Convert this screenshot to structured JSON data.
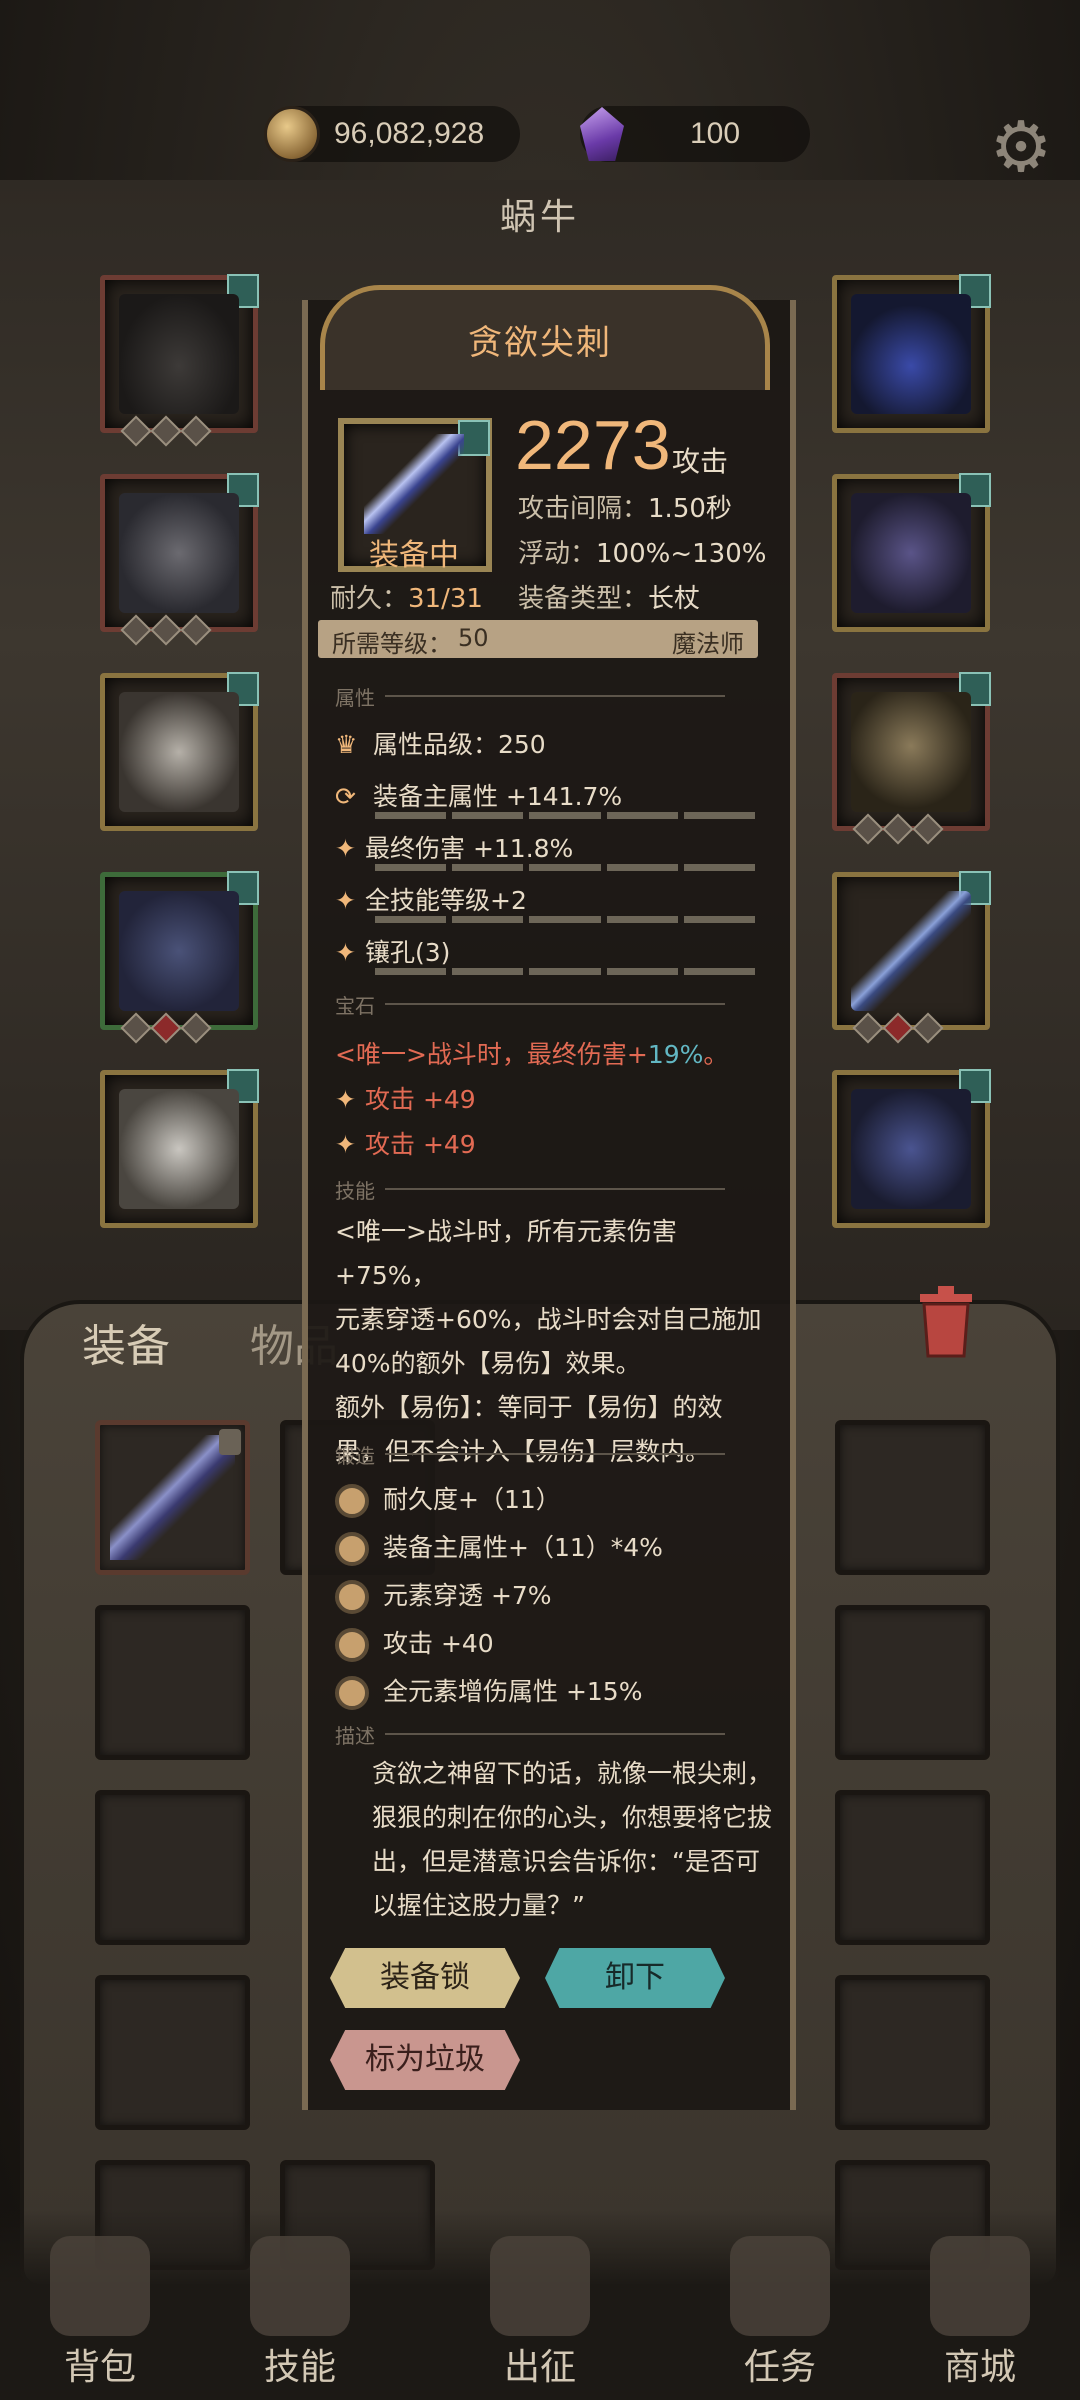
{
  "currency": {
    "gold": "96,082,928",
    "gems": "100"
  },
  "character_name": "蜗牛",
  "inventory_tabs": {
    "equip": "装备",
    "items": "物品"
  },
  "item": {
    "name": "贪欲尖刺",
    "status": "装备中",
    "attack_value": "2273",
    "attack_label": "攻击",
    "attack_interval_label": "攻击间隔：",
    "attack_interval": "1.50秒",
    "variance_label": "浮动：",
    "variance": "100%~130%",
    "durability_label": "耐久：",
    "durability": "31/31",
    "type_label": "装备类型：",
    "type": "长杖",
    "req_level_label": "所需等级：",
    "req_level": "50",
    "req_class": "魔法师"
  },
  "sections": {
    "attributes": "属性",
    "gems": "宝石",
    "skills": "技能",
    "forge": "锻造",
    "description": "描述"
  },
  "attributes": {
    "grade": "属性品级：250",
    "main": "装备主属性 +141.7%",
    "rows": [
      "最终伤害 +11.8%",
      "全技能等级+2",
      "镶孔(3)"
    ]
  },
  "gems": {
    "unique_prefix": "<唯一>战斗时，最终伤害+",
    "unique_value": "19%",
    "unique_suffix": "。",
    "rows": [
      "攻击 +49",
      "攻击 +49"
    ]
  },
  "skill_lines": [
    "<唯一>战斗时，所有元素伤害+75%，",
    "元素穿透+60%，战斗时会对自己施加",
    "40%的额外【易伤】效果。",
    "额外【易伤】：等同于【易伤】的效",
    "果，但不会计入【易伤】层数内。"
  ],
  "forge": [
    "耐久度+（11）",
    "装备主属性+（11）*4%",
    "元素穿透 +7%",
    "攻击 +40",
    "全元素增伤属性 +15%"
  ],
  "description_lines": [
    "贪欲之神留下的话，就像一根尖刺，",
    "狠狠的刺在你的心头，你想要将它拔",
    "出，但是潜意识会告诉你：“是否可",
    "以握住这股力量？”"
  ],
  "buttons": {
    "lock": "装备锁",
    "unequip": "卸下",
    "junk": "标为垃圾"
  },
  "nav": [
    "背包",
    "技能",
    "出征",
    "任务",
    "商城"
  ],
  "colors": {
    "accent": "#f0b77a",
    "highlight_red": "#e26a53",
    "teal": "#62b7c3"
  },
  "icons": [
    "coin-icon",
    "gem-icon",
    "gear-icon",
    "trash-icon",
    "lock-icon"
  ]
}
